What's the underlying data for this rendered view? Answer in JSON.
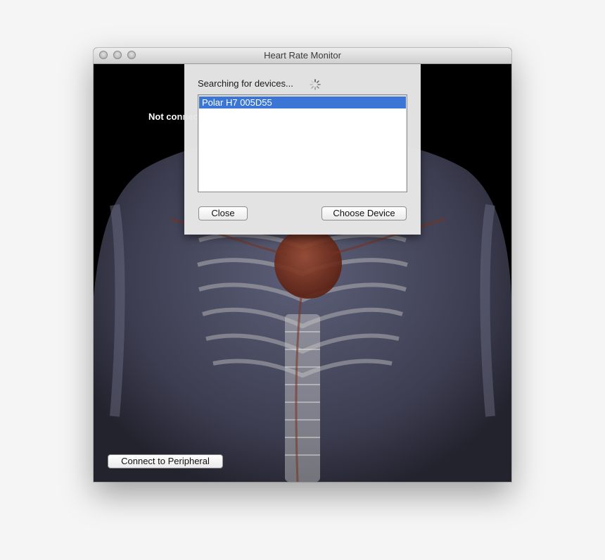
{
  "window": {
    "title": "Heart Rate Monitor"
  },
  "main": {
    "status": "Not connected",
    "connect_button_label": "Connect to Peripheral"
  },
  "device_sheet": {
    "searching_label": "Searching for devices...",
    "devices": [
      {
        "name": "Polar H7 005D55",
        "selected": true
      }
    ],
    "close_button_label": "Close",
    "choose_button_label": "Choose Device"
  },
  "colors": {
    "selection": "#3b76d6",
    "background": "#000000"
  }
}
